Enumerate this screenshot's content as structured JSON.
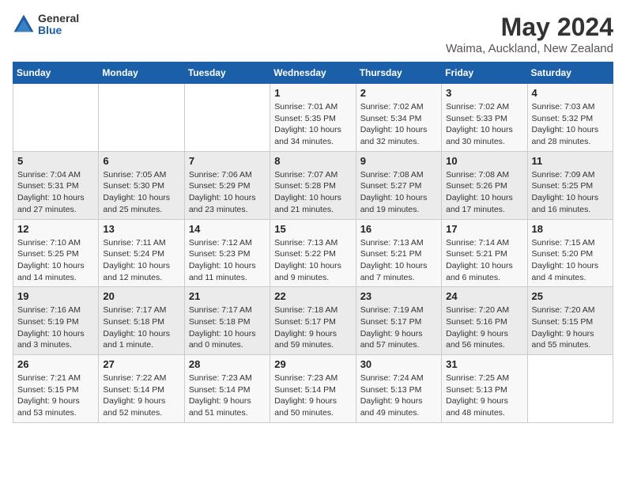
{
  "header": {
    "logo": {
      "general": "General",
      "blue": "Blue"
    },
    "title": "May 2024",
    "subtitle": "Waima, Auckland, New Zealand"
  },
  "weekdays": [
    "Sunday",
    "Monday",
    "Tuesday",
    "Wednesday",
    "Thursday",
    "Friday",
    "Saturday"
  ],
  "weeks": [
    [
      {
        "day": "",
        "info": ""
      },
      {
        "day": "",
        "info": ""
      },
      {
        "day": "",
        "info": ""
      },
      {
        "day": "1",
        "info": "Sunrise: 7:01 AM\nSunset: 5:35 PM\nDaylight: 10 hours\nand 34 minutes."
      },
      {
        "day": "2",
        "info": "Sunrise: 7:02 AM\nSunset: 5:34 PM\nDaylight: 10 hours\nand 32 minutes."
      },
      {
        "day": "3",
        "info": "Sunrise: 7:02 AM\nSunset: 5:33 PM\nDaylight: 10 hours\nand 30 minutes."
      },
      {
        "day": "4",
        "info": "Sunrise: 7:03 AM\nSunset: 5:32 PM\nDaylight: 10 hours\nand 28 minutes."
      }
    ],
    [
      {
        "day": "5",
        "info": "Sunrise: 7:04 AM\nSunset: 5:31 PM\nDaylight: 10 hours\nand 27 minutes."
      },
      {
        "day": "6",
        "info": "Sunrise: 7:05 AM\nSunset: 5:30 PM\nDaylight: 10 hours\nand 25 minutes."
      },
      {
        "day": "7",
        "info": "Sunrise: 7:06 AM\nSunset: 5:29 PM\nDaylight: 10 hours\nand 23 minutes."
      },
      {
        "day": "8",
        "info": "Sunrise: 7:07 AM\nSunset: 5:28 PM\nDaylight: 10 hours\nand 21 minutes."
      },
      {
        "day": "9",
        "info": "Sunrise: 7:08 AM\nSunset: 5:27 PM\nDaylight: 10 hours\nand 19 minutes."
      },
      {
        "day": "10",
        "info": "Sunrise: 7:08 AM\nSunset: 5:26 PM\nDaylight: 10 hours\nand 17 minutes."
      },
      {
        "day": "11",
        "info": "Sunrise: 7:09 AM\nSunset: 5:25 PM\nDaylight: 10 hours\nand 16 minutes."
      }
    ],
    [
      {
        "day": "12",
        "info": "Sunrise: 7:10 AM\nSunset: 5:25 PM\nDaylight: 10 hours\nand 14 minutes."
      },
      {
        "day": "13",
        "info": "Sunrise: 7:11 AM\nSunset: 5:24 PM\nDaylight: 10 hours\nand 12 minutes."
      },
      {
        "day": "14",
        "info": "Sunrise: 7:12 AM\nSunset: 5:23 PM\nDaylight: 10 hours\nand 11 minutes."
      },
      {
        "day": "15",
        "info": "Sunrise: 7:13 AM\nSunset: 5:22 PM\nDaylight: 10 hours\nand 9 minutes."
      },
      {
        "day": "16",
        "info": "Sunrise: 7:13 AM\nSunset: 5:21 PM\nDaylight: 10 hours\nand 7 minutes."
      },
      {
        "day": "17",
        "info": "Sunrise: 7:14 AM\nSunset: 5:21 PM\nDaylight: 10 hours\nand 6 minutes."
      },
      {
        "day": "18",
        "info": "Sunrise: 7:15 AM\nSunset: 5:20 PM\nDaylight: 10 hours\nand 4 minutes."
      }
    ],
    [
      {
        "day": "19",
        "info": "Sunrise: 7:16 AM\nSunset: 5:19 PM\nDaylight: 10 hours\nand 3 minutes."
      },
      {
        "day": "20",
        "info": "Sunrise: 7:17 AM\nSunset: 5:18 PM\nDaylight: 10 hours\nand 1 minute."
      },
      {
        "day": "21",
        "info": "Sunrise: 7:17 AM\nSunset: 5:18 PM\nDaylight: 10 hours\nand 0 minutes."
      },
      {
        "day": "22",
        "info": "Sunrise: 7:18 AM\nSunset: 5:17 PM\nDaylight: 9 hours\nand 59 minutes."
      },
      {
        "day": "23",
        "info": "Sunrise: 7:19 AM\nSunset: 5:17 PM\nDaylight: 9 hours\nand 57 minutes."
      },
      {
        "day": "24",
        "info": "Sunrise: 7:20 AM\nSunset: 5:16 PM\nDaylight: 9 hours\nand 56 minutes."
      },
      {
        "day": "25",
        "info": "Sunrise: 7:20 AM\nSunset: 5:15 PM\nDaylight: 9 hours\nand 55 minutes."
      }
    ],
    [
      {
        "day": "26",
        "info": "Sunrise: 7:21 AM\nSunset: 5:15 PM\nDaylight: 9 hours\nand 53 minutes."
      },
      {
        "day": "27",
        "info": "Sunrise: 7:22 AM\nSunset: 5:14 PM\nDaylight: 9 hours\nand 52 minutes."
      },
      {
        "day": "28",
        "info": "Sunrise: 7:23 AM\nSunset: 5:14 PM\nDaylight: 9 hours\nand 51 minutes."
      },
      {
        "day": "29",
        "info": "Sunrise: 7:23 AM\nSunset: 5:14 PM\nDaylight: 9 hours\nand 50 minutes."
      },
      {
        "day": "30",
        "info": "Sunrise: 7:24 AM\nSunset: 5:13 PM\nDaylight: 9 hours\nand 49 minutes."
      },
      {
        "day": "31",
        "info": "Sunrise: 7:25 AM\nSunset: 5:13 PM\nDaylight: 9 hours\nand 48 minutes."
      },
      {
        "day": "",
        "info": ""
      }
    ]
  ]
}
